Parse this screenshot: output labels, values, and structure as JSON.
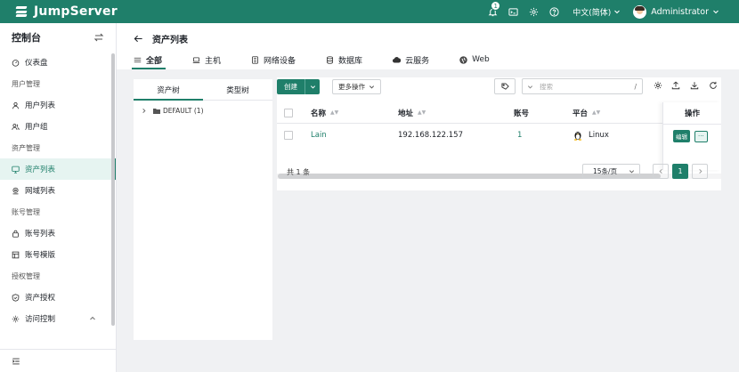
{
  "app": {
    "logo_text": "JumpServer"
  },
  "topbar": {
    "notification_count": "1",
    "language": "中文(简体)",
    "user_name": "Administrator"
  },
  "sidebar": {
    "title": "控制台",
    "items": [
      {
        "type": "item",
        "label": "仪表盘",
        "icon": "dashboard-icon"
      },
      {
        "type": "group",
        "label": "用户管理"
      },
      {
        "type": "item",
        "label": "用户列表",
        "icon": "user-icon"
      },
      {
        "type": "item",
        "label": "用户组",
        "icon": "users-icon"
      },
      {
        "type": "group",
        "label": "资产管理"
      },
      {
        "type": "item",
        "label": "资产列表",
        "icon": "monitor-icon",
        "active": true
      },
      {
        "type": "item",
        "label": "网域列表",
        "icon": "location-icon"
      },
      {
        "type": "group",
        "label": "账号管理"
      },
      {
        "type": "item",
        "label": "账号列表",
        "icon": "lock-icon"
      },
      {
        "type": "item",
        "label": "账号模版",
        "icon": "template-icon"
      },
      {
        "type": "group",
        "label": "授权管理"
      },
      {
        "type": "item",
        "label": "资产授权",
        "icon": "shield-icon"
      },
      {
        "type": "item",
        "label": "访问控制",
        "icon": "gear-icon"
      }
    ]
  },
  "page": {
    "title": "资产列表",
    "tabs": [
      {
        "label": "全部",
        "icon": "list-icon",
        "active": true
      },
      {
        "label": "主机",
        "icon": "laptop-icon"
      },
      {
        "label": "网络设备",
        "icon": "network-icon"
      },
      {
        "label": "数据库",
        "icon": "database-icon"
      },
      {
        "label": "云服务",
        "icon": "cloud-icon"
      },
      {
        "label": "Web",
        "icon": "globe-icon"
      }
    ]
  },
  "tree": {
    "tabs": [
      "资产树",
      "类型树"
    ],
    "root": "DEFAULT (1)"
  },
  "toolbar": {
    "create_label": "创建",
    "more_label": "更多操作",
    "search_placeholder": "搜索",
    "search_hint": "/"
  },
  "table": {
    "columns": [
      "名称",
      "地址",
      "账号",
      "平台",
      "操作"
    ],
    "rows": [
      {
        "name": "Lain",
        "address": "192.168.122.157",
        "accounts": "1",
        "platform": "Linux"
      }
    ],
    "edit_label": "编辑",
    "more_label": "···"
  },
  "pagination": {
    "total": "共 1 条",
    "page_size": "15条/页",
    "current": "1"
  },
  "colors": {
    "brand": "#1f7f6a",
    "active_bg": "#e6f4f1"
  }
}
